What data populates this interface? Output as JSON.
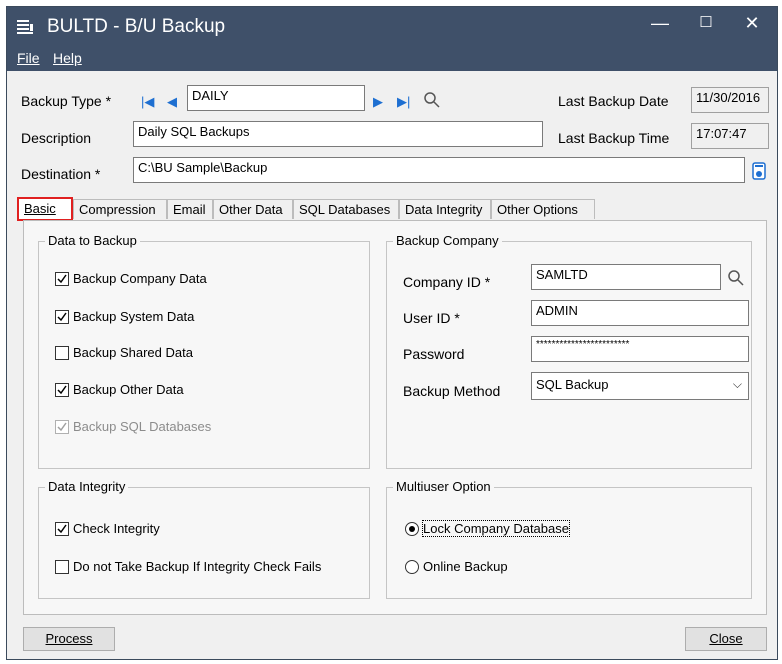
{
  "window": {
    "title": "BULTD - B/U Backup",
    "minimize": "—",
    "maximize": "☐",
    "close": "✕"
  },
  "menu": [
    {
      "label": "File"
    },
    {
      "label": "Help"
    }
  ],
  "header": {
    "backup_type_label": "Backup Type *",
    "backup_type_value": "DAILY",
    "last_backup_date_label": "Last Backup Date",
    "last_backup_date_value": "11/30/2016",
    "description_label": "Description",
    "description_value": "Daily SQL Backups",
    "last_backup_time_label": "Last Backup Time",
    "last_backup_time_value": "17:07:47",
    "destination_label": "Destination *",
    "destination_value": "C:\\BU Sample\\Backup"
  },
  "tabs": [
    {
      "label": "Basic",
      "active": true
    },
    {
      "label": "Compression"
    },
    {
      "label": "Email"
    },
    {
      "label": "Other Data"
    },
    {
      "label": "SQL Databases"
    },
    {
      "label": "Data Integrity"
    },
    {
      "label": "Other Options"
    }
  ],
  "data_to_backup": {
    "title": "Data to Backup",
    "items": [
      {
        "label": "Backup Company Data",
        "checked": true
      },
      {
        "label": "Backup System Data",
        "checked": true
      },
      {
        "label": "Backup Shared Data",
        "checked": false
      },
      {
        "label": "Backup Other Data",
        "checked": true
      },
      {
        "label": "Backup SQL Databases",
        "checked": true,
        "disabled": true
      }
    ]
  },
  "backup_company": {
    "title": "Backup Company",
    "company_id_label": "Company ID *",
    "company_id_value": "SAMLTD",
    "user_id_label": "User ID *",
    "user_id_value": "ADMIN",
    "password_label": "Password",
    "password_value": "************************",
    "backup_method_label": "Backup Method",
    "backup_method_value": "SQL Backup"
  },
  "data_integrity": {
    "title": "Data Integrity",
    "items": [
      {
        "label": "Check Integrity",
        "checked": true
      },
      {
        "label": "Do not Take Backup If Integrity Check Fails",
        "checked": false
      }
    ]
  },
  "multiuser": {
    "title": "Multiuser Option",
    "options": [
      {
        "label": "Lock Company Database",
        "selected": true
      },
      {
        "label": "Online Backup",
        "selected": false
      }
    ]
  },
  "footer": {
    "process_label": "Process",
    "close_label": "Close"
  }
}
